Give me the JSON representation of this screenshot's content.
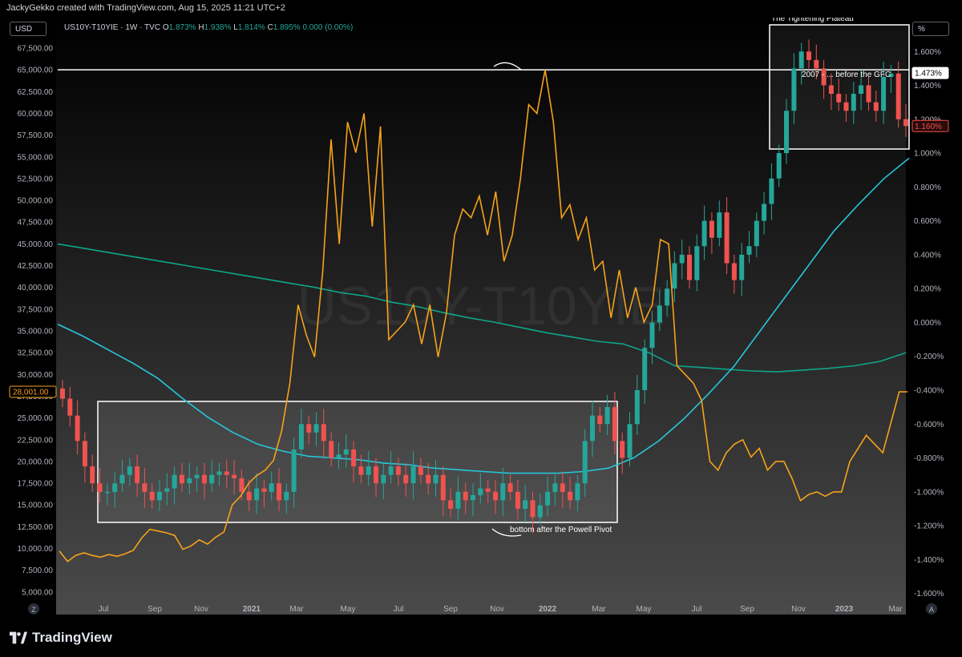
{
  "header": {
    "credit": "JackyGekko created with TradingView.com, Aug 15, 2025 11:21 UTC+2"
  },
  "toolbar": {
    "currency": "USD",
    "percent": "%"
  },
  "legend": {
    "symbol": "US10Y-T10YIE · 1W · TVC",
    "o_label": "O",
    "o_value": "1.873%",
    "h_label": "H",
    "h_value": "1.938%",
    "l_label": "L",
    "l_value": "1.814%",
    "c_label": "C",
    "c_value": "1.895%",
    "change": "0.000 (0.00%)"
  },
  "watermark": "US10Y-T10YIE",
  "brand": "TradingView",
  "colors": {
    "up": "#26a69a",
    "down": "#ef5350",
    "orange": "#f7a21b",
    "ma_long": "#0ea58b",
    "ma_fast": "#26c6da",
    "box": "#ffffff"
  },
  "chart_data": {
    "type": "line",
    "title": "US10Y-T10YIE · 1W · TVC",
    "x": [
      "Jul",
      "Sep",
      "Nov",
      "2021",
      "Mar",
      "May",
      "Jul",
      "Sep",
      "Nov",
      "2022",
      "Mar",
      "May",
      "Jul",
      "Sep",
      "Nov",
      "2023",
      "Mar"
    ],
    "left_axis": {
      "label": "USD",
      "ylim": [
        2500,
        71000
      ],
      "ticks": [
        "5,000.00",
        "7,500.00",
        "10,000.00",
        "12,500.00",
        "15,000.00",
        "17,500.00",
        "20,000.00",
        "22,500.00",
        "25,000.00",
        "27,500.00",
        "30,000.00",
        "32,500.00",
        "35,000.00",
        "37,500.00",
        "40,000.00",
        "42,500.00",
        "45,000.00",
        "47,500.00",
        "50,000.00",
        "52,500.00",
        "55,000.00",
        "57,500.00",
        "60,000.00",
        "62,500.00",
        "65,000.00",
        "67,500.00"
      ],
      "marker": "28,001.00"
    },
    "right_axis": {
      "label": "%",
      "ylim": [
        -1.72,
        1.8
      ],
      "ticks": [
        "-1.600%",
        "-1.400%",
        "-1.200%",
        "-1.000%",
        "-0.800%",
        "-0.600%",
        "-0.400%",
        "-0.200%",
        "0.000%",
        "0.200%",
        "0.400%",
        "0.600%",
        "0.800%",
        "1.000%",
        "1.200%",
        "1.400%",
        "1.600%"
      ],
      "markers": [
        "1.473%",
        "1.160%"
      ]
    },
    "series": [
      {
        "name": "Orange series (left axis)",
        "axis": "left",
        "values": [
          9700,
          8500,
          9200,
          9500,
          9200,
          9000,
          9300,
          9100,
          9400,
          9800,
          11200,
          12200,
          12000,
          11800,
          11500,
          9900,
          10300,
          11000,
          10500,
          11300,
          11900,
          15000,
          16000,
          17500,
          18400,
          19000,
          20100,
          23500,
          29000,
          38000,
          34500,
          32000,
          42000,
          57000,
          45000,
          59000,
          55500,
          60000,
          47000,
          58500,
          34000,
          35000,
          36000,
          38000,
          33500,
          38000,
          32000,
          37000,
          46000,
          49000,
          48000,
          50500,
          46000,
          51000,
          43000,
          46000,
          52500,
          61000,
          60000,
          65000,
          59000,
          48000,
          49500,
          45500,
          48000,
          42000,
          43000,
          36500,
          42000,
          36500,
          40000,
          36000,
          38000,
          45500,
          45000,
          31000,
          30000,
          29000,
          27000,
          20000,
          19000,
          21000,
          22000,
          22500,
          20500,
          21500,
          19000,
          20000,
          20000,
          18000,
          15500,
          16200,
          16500,
          16000,
          16500,
          16500,
          20000,
          21500,
          23000,
          22000,
          21000,
          24500,
          28000,
          28000
        ]
      },
      {
        "name": "Long moving average (left axis)",
        "axis": "left",
        "values": [
          45000,
          44500,
          44000,
          43500,
          43000,
          42500,
          42000,
          41500,
          41000,
          40500,
          40000,
          39400,
          39000,
          38300,
          37800,
          37100,
          36500,
          36000,
          35400,
          34800,
          34300,
          33800,
          33500,
          32500,
          31000,
          30800,
          30600,
          30400,
          30300,
          30500,
          30700,
          31000,
          31500,
          32500
        ]
      },
      {
        "name": "Fast moving average (right axis)",
        "axis": "right",
        "values": [
          -0.01,
          -0.08,
          -0.16,
          -0.24,
          -0.33,
          -0.45,
          -0.56,
          -0.65,
          -0.72,
          -0.76,
          -0.79,
          -0.8,
          -0.81,
          -0.83,
          -0.84,
          -0.86,
          -0.87,
          -0.88,
          -0.89,
          -0.89,
          -0.89,
          -0.88,
          -0.86,
          -0.8,
          -0.7,
          -0.57,
          -0.42,
          -0.26,
          -0.06,
          0.14,
          0.34,
          0.54,
          0.7,
          0.85,
          0.97
        ]
      },
      {
        "name": "US10Y-T10YIE weekly candles (right axis)",
        "axis": "right",
        "candles_close": [
          -0.45,
          -0.55,
          -0.7,
          -0.85,
          -0.95,
          -1.0,
          -1.0,
          -0.95,
          -0.9,
          -0.85,
          -0.95,
          -1.0,
          -1.05,
          -1.0,
          -0.98,
          -0.9,
          -0.95,
          -0.92,
          -0.9,
          -0.95,
          -0.9,
          -0.88,
          -0.9,
          -0.92,
          -1.0,
          -1.05,
          -0.98,
          -1.0,
          -0.95,
          -1.05,
          -1.0,
          -0.75,
          -0.6,
          -0.65,
          -0.6,
          -0.7,
          -0.8,
          -0.78,
          -0.75,
          -0.85,
          -0.9,
          -0.85,
          -0.95,
          -0.9,
          -0.85,
          -0.9,
          -0.95,
          -0.85,
          -0.9,
          -0.95,
          -0.9,
          -1.05,
          -1.1,
          -1.0,
          -1.05,
          -1.02,
          -0.98,
          -1.0,
          -1.05,
          -0.95,
          -1.0,
          -1.1,
          -1.05,
          -1.15,
          -1.08,
          -1.0,
          -0.95,
          -1.0,
          -1.05,
          -0.95,
          -0.7,
          -0.55,
          -0.6,
          -0.5,
          -0.7,
          -0.8,
          -0.6,
          -0.4,
          -0.15,
          0.0,
          0.1,
          0.2,
          0.35,
          0.4,
          0.25,
          0.45,
          0.6,
          0.5,
          0.65,
          0.35,
          0.25,
          0.4,
          0.45,
          0.6,
          0.7,
          0.85,
          1.0,
          1.25,
          1.5,
          1.6,
          1.55,
          1.5,
          1.4,
          1.35,
          1.3,
          1.25,
          1.35,
          1.4,
          1.3,
          1.25,
          1.45,
          1.47,
          1.2,
          1.16
        ],
        "last_close": 1.895
      }
    ],
    "annotations": [
      {
        "text": "The Tightening Plateau"
      },
      {
        "text": "2007 - ... before the GFC"
      },
      {
        "text": "bottom after the Powell Pivot"
      }
    ],
    "grid": false,
    "legend_position": "top-left"
  }
}
